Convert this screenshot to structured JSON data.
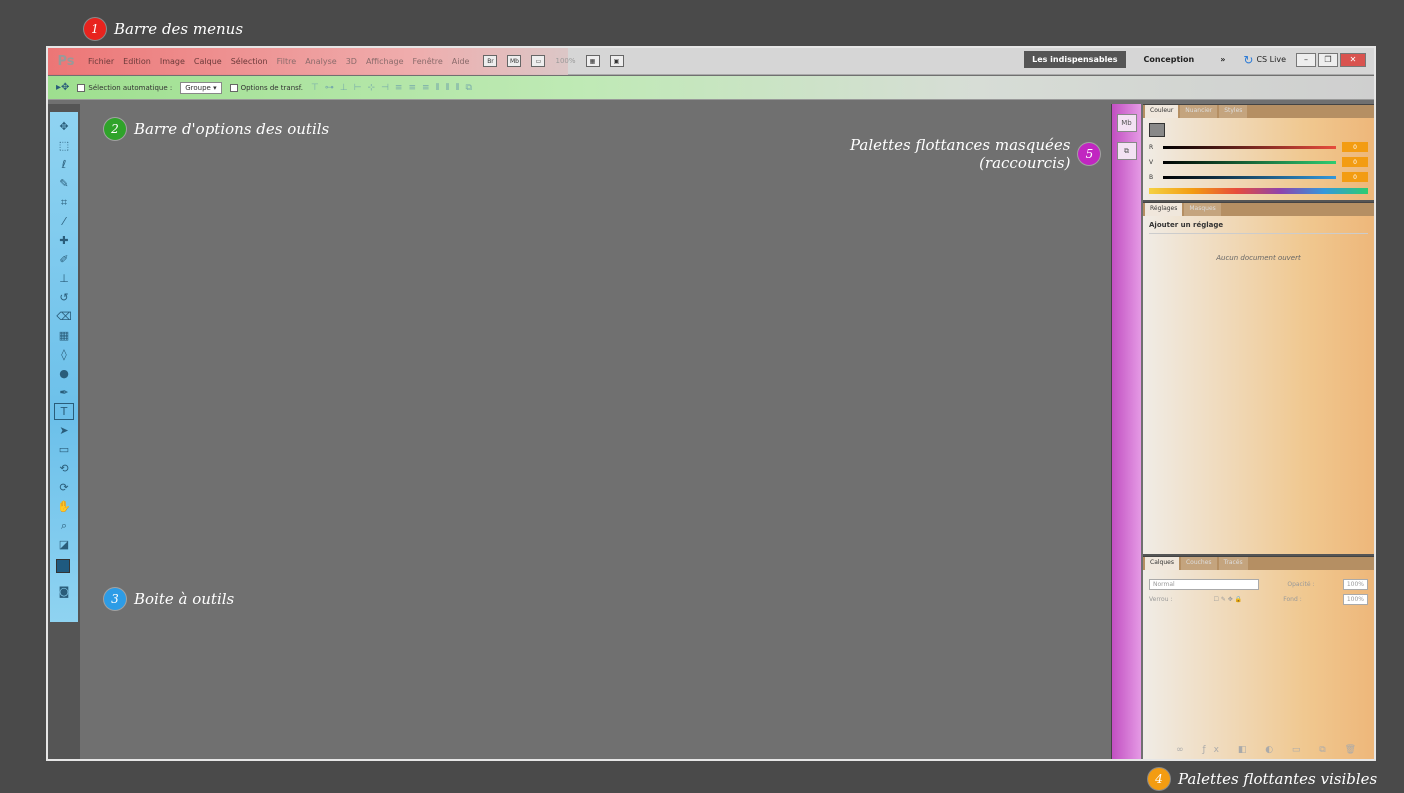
{
  "annotations": {
    "a1": {
      "num": "1",
      "label": "Barre des menus",
      "color": "#e8231e"
    },
    "a2": {
      "num": "2",
      "label": "Barre d'options des outils",
      "color": "#2fa32a"
    },
    "a3": {
      "num": "3",
      "label": "Boite à outils",
      "color": "#2d9ce6"
    },
    "a4": {
      "num": "4",
      "label": "Palettes flottantes visibles",
      "color": "#f39c12"
    },
    "a5": {
      "num": "5",
      "label_line1": "Palettes flottances masquées",
      "label_line2": "(raccourcis)",
      "color": "#c126c1"
    }
  },
  "menubar": {
    "logo": "Ps",
    "items": [
      "Fichier",
      "Edition",
      "Image",
      "Calque",
      "Sélection",
      "Filtre",
      "Analyse",
      "3D",
      "Affichage",
      "Fenêtre",
      "Aide"
    ],
    "icons": [
      "Br",
      "Mb"
    ],
    "zoom": "100%",
    "workspace_active": "Les indispensables",
    "workspace_other": "Conception",
    "more": "»",
    "cslive": "CS Live"
  },
  "optbar": {
    "auto_select": "Sélection automatique :",
    "group": "Groupe",
    "transform": "Options de transf."
  },
  "panels": {
    "color": {
      "tabs": [
        "Couleur",
        "Nuancier",
        "Styles"
      ],
      "r": "R",
      "v": "V",
      "b": "B",
      "r_val": "0",
      "v_val": "0",
      "b_val": "0"
    },
    "adjust": {
      "tabs": [
        "Réglages",
        "Masques"
      ],
      "title": "Ajouter un réglage",
      "empty": "Aucun document ouvert"
    },
    "layers": {
      "tabs": [
        "Calques",
        "Couches",
        "Tracés"
      ],
      "mode": "Normal",
      "opacity_label": "Opacité :",
      "opacity": "100%",
      "lock_label": "Verrou :",
      "fill_label": "Fond :",
      "fill": "100%"
    }
  }
}
